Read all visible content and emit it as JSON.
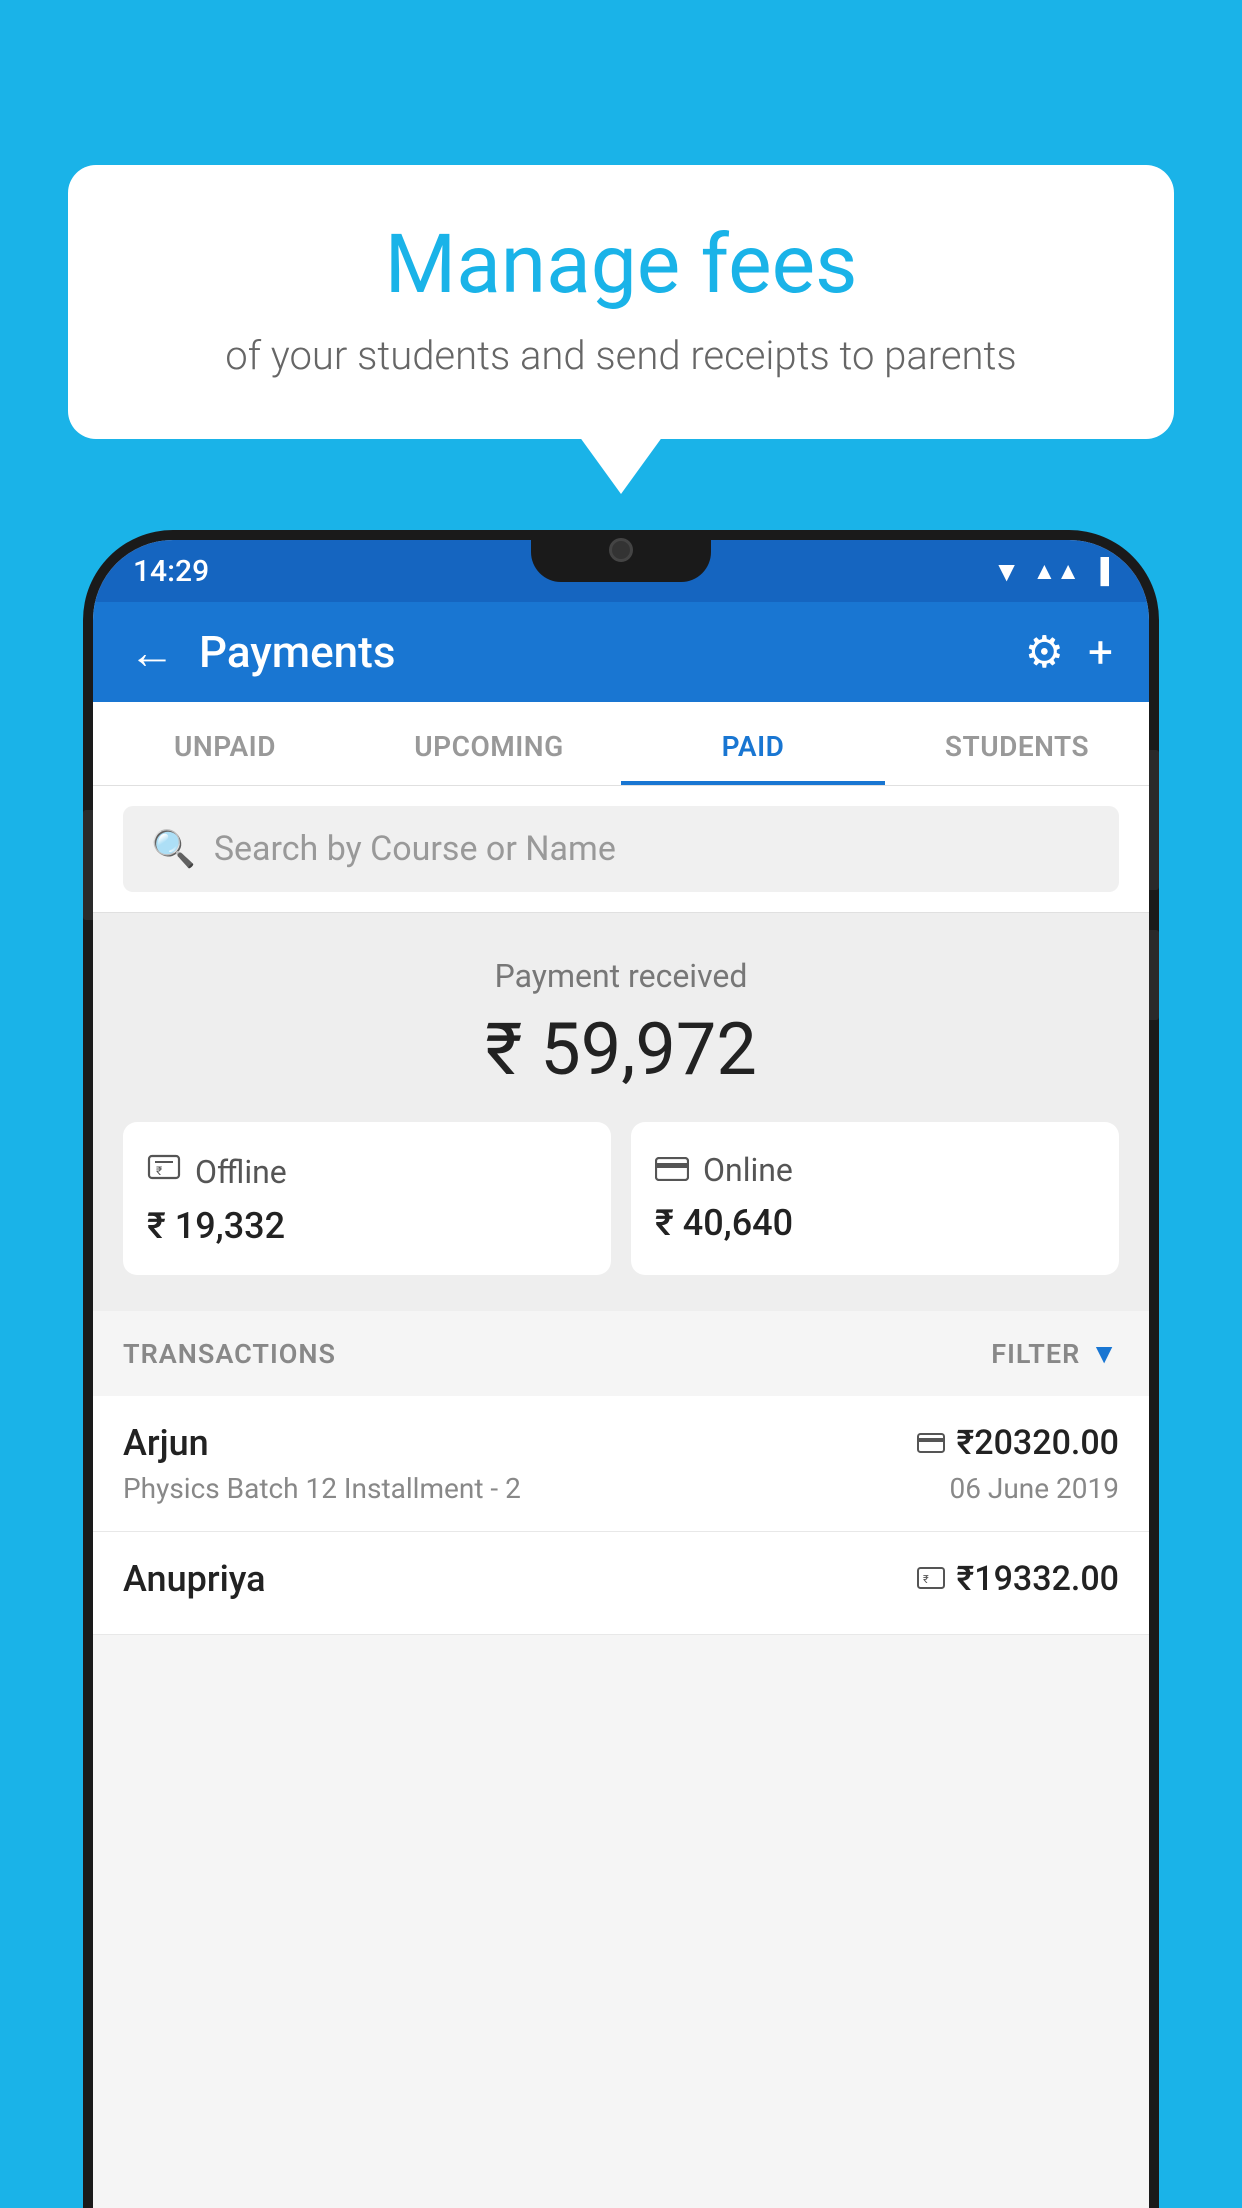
{
  "background_color": "#1ab3e8",
  "bubble": {
    "title": "Manage fees",
    "subtitle": "of your students and send receipts to parents"
  },
  "status_bar": {
    "time": "14:29"
  },
  "toolbar": {
    "title": "Payments",
    "back_label": "←",
    "gear_label": "⚙",
    "plus_label": "+"
  },
  "tabs": [
    {
      "label": "UNPAID",
      "active": false
    },
    {
      "label": "UPCOMING",
      "active": false
    },
    {
      "label": "PAID",
      "active": true
    },
    {
      "label": "STUDENTS",
      "active": false
    }
  ],
  "search": {
    "placeholder": "Search by Course or Name"
  },
  "payment_summary": {
    "label": "Payment received",
    "total": "₹ 59,972",
    "offline": {
      "type": "Offline",
      "amount": "₹ 19,332"
    },
    "online": {
      "type": "Online",
      "amount": "₹ 40,640"
    }
  },
  "transactions": {
    "header": "TRANSACTIONS",
    "filter_label": "FILTER",
    "rows": [
      {
        "name": "Arjun",
        "course": "Physics Batch 12 Installment - 2",
        "amount": "₹20320.00",
        "date": "06 June 2019",
        "payment_type": "online"
      },
      {
        "name": "Anupriya",
        "course": "",
        "amount": "₹19332.00",
        "date": "",
        "payment_type": "offline"
      }
    ]
  }
}
